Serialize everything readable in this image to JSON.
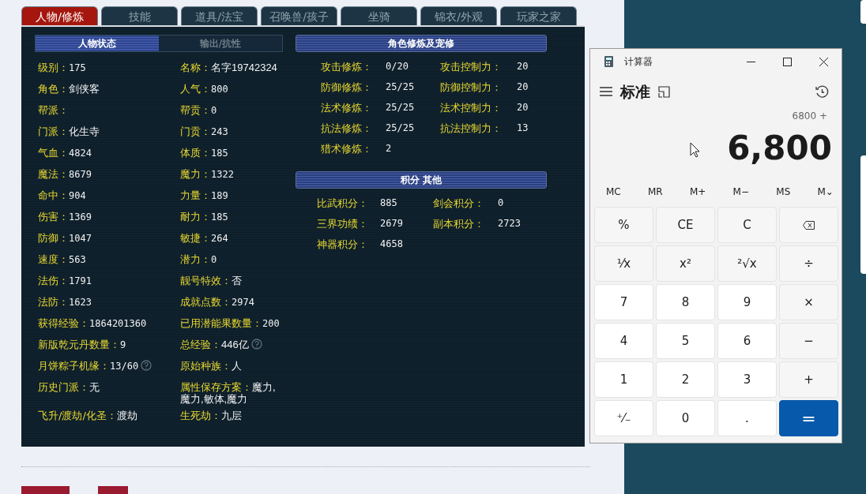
{
  "tabs": [
    {
      "label": "人物/修炼",
      "selected": true
    },
    {
      "label": "技能",
      "selected": false
    },
    {
      "label": "道具/法宝",
      "selected": false
    },
    {
      "label": "召唤兽/孩子",
      "selected": false
    },
    {
      "label": "坐骑",
      "selected": false
    },
    {
      "label": "锦衣/外观",
      "selected": false
    },
    {
      "label": "玩家之家",
      "selected": false
    }
  ],
  "subtabs": [
    {
      "label": "人物状态",
      "selected": true
    },
    {
      "label": "输出/抗性",
      "selected": false
    }
  ],
  "stats": [
    {
      "label": "级别：",
      "value": "175"
    },
    {
      "label": "名称：",
      "value": "名字19742324"
    },
    {
      "label": "角色：",
      "value": "剑侠客"
    },
    {
      "label": "人气：",
      "value": "800"
    },
    {
      "label": "帮派："
    },
    {
      "label": "帮贡：",
      "value": "0"
    },
    {
      "label": "门派：",
      "value": "化生寺"
    },
    {
      "label": "门贡：",
      "value": "243"
    },
    {
      "label": "气血：",
      "value": "4824"
    },
    {
      "label": "体质：",
      "value": "185"
    },
    {
      "label": "魔法：",
      "value": "8679"
    },
    {
      "label": "魔力：",
      "value": "1322"
    },
    {
      "label": "命中：",
      "value": "904"
    },
    {
      "label": "力量：",
      "value": "189"
    },
    {
      "label": "伤害：",
      "value": "1369"
    },
    {
      "label": "耐力：",
      "value": "185"
    },
    {
      "label": "防御：",
      "value": "1047"
    },
    {
      "label": "敏捷：",
      "value": "264"
    },
    {
      "label": "速度：",
      "value": "563"
    },
    {
      "label": "潜力：",
      "value": "0"
    },
    {
      "label": "法伤：",
      "value": "1791"
    },
    {
      "label": "靓号特效：",
      "value": "否"
    },
    {
      "label": "法防：",
      "value": "1623"
    },
    {
      "label": "成就点数：",
      "value": "2974"
    },
    {
      "label": "获得经验：",
      "value": "1864201360"
    },
    {
      "label": "已用潜能果数量：",
      "value": "200"
    },
    {
      "label": "新版乾元丹数量：",
      "value": "9"
    },
    {
      "label": "总经验：",
      "value": "446亿",
      "help": true
    },
    {
      "label": "月饼粽子机缘：",
      "value": "13/60",
      "help": true
    },
    {
      "label": "原始种族：",
      "value": "人"
    },
    {
      "label": "历史门派：",
      "value": "无"
    },
    {
      "label": "属性保存方案：",
      "value": "魔力,魔力,敏体,魔力"
    },
    {
      "label": "飞升/渡劫/化圣：",
      "value": "渡劫"
    },
    {
      "label": "生死劫：",
      "value": "九层"
    }
  ],
  "cultivation": {
    "title": "角色修炼及宠修",
    "items": [
      {
        "label": "攻击修炼：",
        "value": "0/20"
      },
      {
        "label": "攻击控制力：",
        "value": "20"
      },
      {
        "label": "防御修炼：",
        "value": "25/25"
      },
      {
        "label": "防御控制力：",
        "value": "20"
      },
      {
        "label": "法术修炼：",
        "value": "25/25"
      },
      {
        "label": "法术控制力：",
        "value": "20"
      },
      {
        "label": "抗法修炼：",
        "value": "25/25"
      },
      {
        "label": "抗法控制力：",
        "value": "13"
      },
      {
        "label": "猎术修炼：",
        "value": "2"
      }
    ]
  },
  "points": {
    "title": "积分 其他",
    "items": [
      {
        "label": "比武积分：",
        "value": "885"
      },
      {
        "label": "剑会积分：",
        "value": "0"
      },
      {
        "label": "三界功绩：",
        "value": "2679"
      },
      {
        "label": "副本积分：",
        "value": "2723"
      },
      {
        "label": "神器积分：",
        "value": "4658"
      }
    ]
  },
  "calculator": {
    "title": "计算器",
    "mode": "标准",
    "expression": "6800 +",
    "display": "6,800",
    "memory": [
      "MC",
      "MR",
      "M+",
      "M−",
      "MS",
      "M⌄"
    ],
    "keys": [
      {
        "kind": "fn",
        "label": "%"
      },
      {
        "kind": "fn",
        "label": "CE"
      },
      {
        "kind": "fn",
        "label": "C"
      },
      {
        "kind": "backspace"
      },
      {
        "kind": "fn",
        "label": "¹⁄x"
      },
      {
        "kind": "fn",
        "label": "x²"
      },
      {
        "kind": "fn",
        "label": "²√x"
      },
      {
        "kind": "fn",
        "label": "÷"
      },
      {
        "kind": "digit",
        "label": "7"
      },
      {
        "kind": "digit",
        "label": "8"
      },
      {
        "kind": "digit",
        "label": "9"
      },
      {
        "kind": "fn",
        "label": "×"
      },
      {
        "kind": "digit",
        "label": "4"
      },
      {
        "kind": "digit",
        "label": "5"
      },
      {
        "kind": "digit",
        "label": "6"
      },
      {
        "kind": "fn",
        "label": "−"
      },
      {
        "kind": "digit",
        "label": "1"
      },
      {
        "kind": "digit",
        "label": "2"
      },
      {
        "kind": "digit",
        "label": "3"
      },
      {
        "kind": "fn",
        "label": "+"
      },
      {
        "kind": "digit",
        "label": "⁺⁄₋"
      },
      {
        "kind": "digit",
        "label": "0"
      },
      {
        "kind": "digit",
        "label": "."
      },
      {
        "kind": "equals",
        "label": "="
      }
    ]
  }
}
